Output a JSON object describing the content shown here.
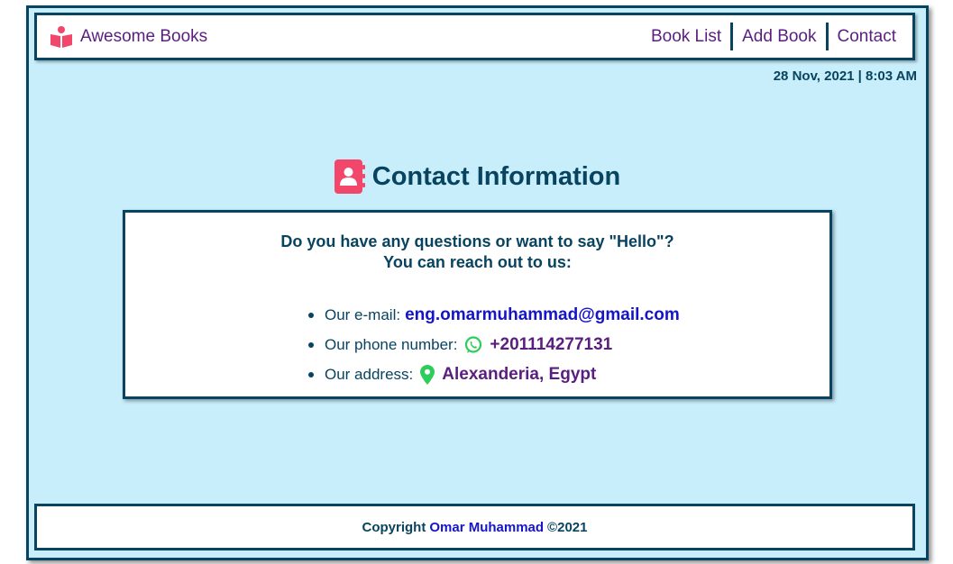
{
  "brand": {
    "name": "Awesome Books",
    "icon": "book-reader-icon"
  },
  "nav": {
    "items": [
      {
        "label": "Book List"
      },
      {
        "label": "Add Book"
      },
      {
        "label": "Contact"
      }
    ]
  },
  "datetime": "28 Nov, 2021 | 8:03 AM",
  "contact": {
    "title": "Contact Information",
    "icon": "address-book-icon",
    "intro_line1": "Do you have any questions or want to say \"Hello\"?",
    "intro_line2": "You can reach out to us:",
    "email_label": "Our e-mail:",
    "email": "eng.omarmuhammad@gmail.com",
    "phone_label": "Our phone number:",
    "phone": "+201114277131",
    "phone_icon": "whatsapp-icon",
    "address_label": "Our address:",
    "address": "Alexanderia, Egypt",
    "address_icon": "map-marker-icon"
  },
  "footer": {
    "prefix": "Copyright",
    "author": "Omar Muhammad",
    "suffix": "©2021"
  },
  "colors": {
    "navy": "#08435f",
    "purple": "#5a1f7e",
    "pink": "#f2476b",
    "green": "#2ecc5a",
    "link": "#1515c8",
    "background": "#c8eefb"
  }
}
